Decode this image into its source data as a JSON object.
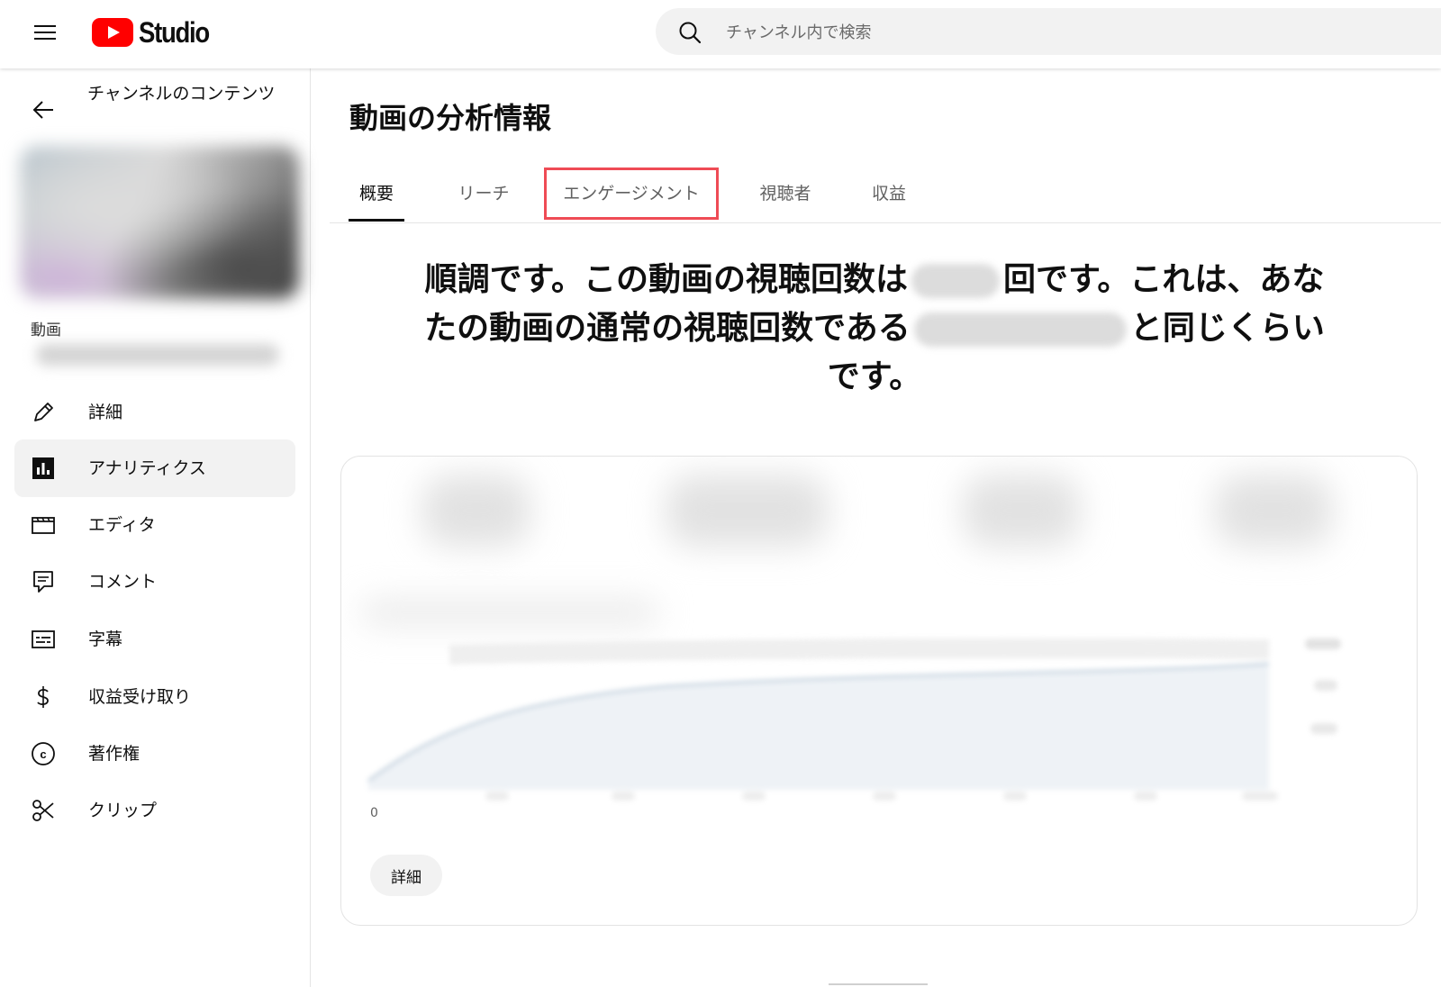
{
  "app": {
    "logo_text": "Studio",
    "brand_color": "#ff0000",
    "search_placeholder": "チャンネル内で検索"
  },
  "sidebar": {
    "back_label": "チャンネルのコンテンツ",
    "video_label": "動画",
    "items": [
      {
        "label": "詳細",
        "icon": "pencil-icon",
        "active": false
      },
      {
        "label": "アナリティクス",
        "icon": "analytics-icon",
        "active": true
      },
      {
        "label": "エディタ",
        "icon": "clapperboard-icon",
        "active": false
      },
      {
        "label": "コメント",
        "icon": "comment-icon",
        "active": false
      },
      {
        "label": "字幕",
        "icon": "subtitles-icon",
        "active": false
      },
      {
        "label": "収益受け取り",
        "icon": "dollar-icon",
        "active": false
      },
      {
        "label": "著作権",
        "icon": "copyright-icon",
        "active": false
      },
      {
        "label": "クリップ",
        "icon": "scissors-icon",
        "active": false
      }
    ]
  },
  "main": {
    "title": "動画の分析情報",
    "tabs": [
      {
        "label": "概要",
        "active": true
      },
      {
        "label": "リーチ",
        "active": false
      },
      {
        "label": "エンゲージメント",
        "active": false,
        "highlighted": true
      },
      {
        "label": "視聴者",
        "active": false
      },
      {
        "label": "収益",
        "active": false
      }
    ],
    "highlight_color": "#ef4b55",
    "headline": {
      "part1": "順調です。この動画の視聴回数は",
      "part2": "回です。これは、あなたの動画の通常の視聴回数である",
      "part3": "と同じくらいです。"
    },
    "card": {
      "axis_zero": "0",
      "detail_button": "詳細"
    }
  }
}
